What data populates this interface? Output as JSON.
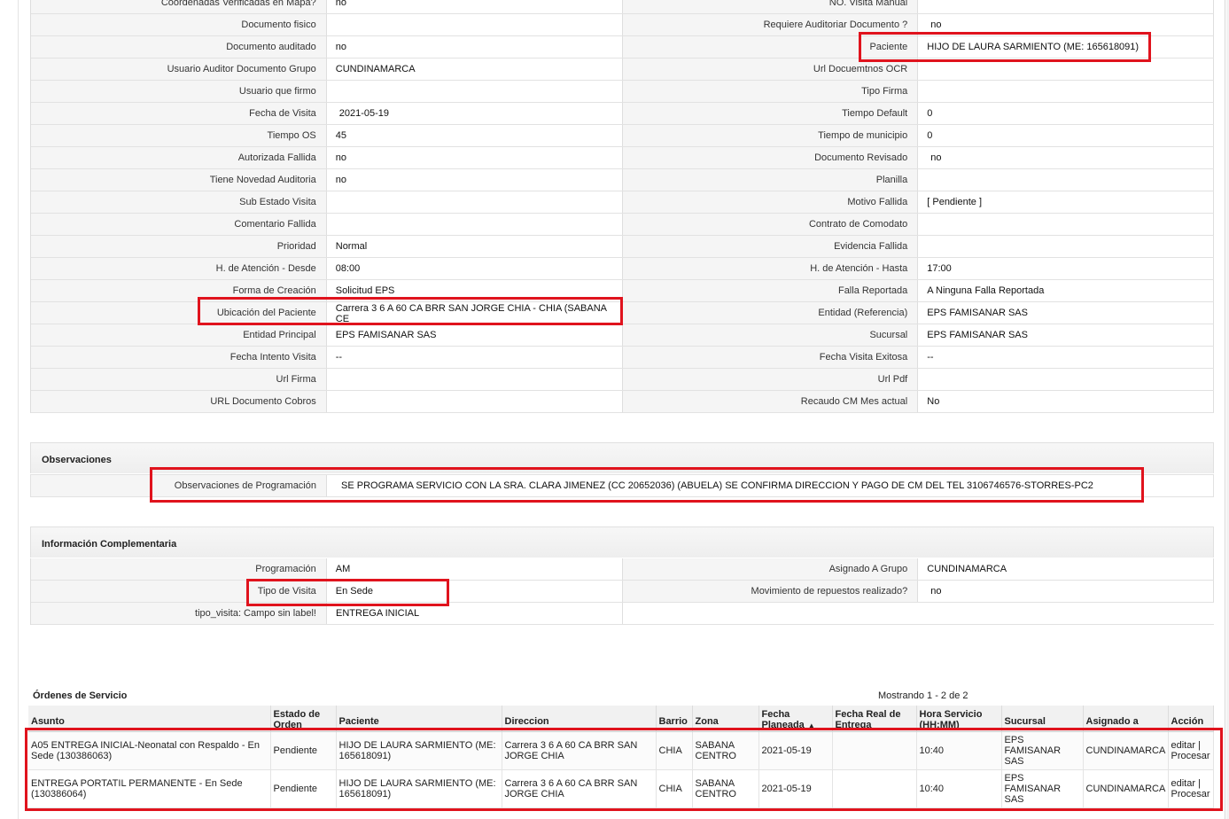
{
  "details_left": [
    {
      "label": "Coordenadas Verificadas en Mapa?",
      "value": "no"
    },
    {
      "label": "Documento fisico",
      "value": ""
    },
    {
      "label": "Documento auditado",
      "value": "no"
    },
    {
      "label": "Usuario Auditor Documento Grupo",
      "value": "CUNDINAMARCA"
    },
    {
      "label": "Usuario que firmo",
      "value": ""
    },
    {
      "label": "Fecha de Visita",
      "value": "2021-05-19"
    },
    {
      "label": "Tiempo OS",
      "value": "45"
    },
    {
      "label": "Autorizada Fallida",
      "value": "no"
    },
    {
      "label": "Tiene Novedad Auditoria",
      "value": "no"
    },
    {
      "label": "Sub Estado Visita",
      "value": ""
    },
    {
      "label": "Comentario Fallida",
      "value": ""
    },
    {
      "label": "Prioridad",
      "value": "Normal"
    },
    {
      "label": "H. de Atención - Desde",
      "value": "08:00"
    },
    {
      "label": "Forma de Creación",
      "value": "Solicitud EPS"
    },
    {
      "label": "Ubicación del Paciente",
      "value": "Carrera 3 6 A 60 CA BRR SAN JORGE CHIA - CHIA (SABANA CE"
    },
    {
      "label": "Entidad Principal",
      "value": "EPS FAMISANAR SAS"
    },
    {
      "label": "Fecha Intento Visita",
      "value": "--"
    },
    {
      "label": "Url Firma",
      "value": ""
    },
    {
      "label": "URL Documento Cobros",
      "value": ""
    }
  ],
  "details_right": [
    {
      "label": "NO. Visita Manual",
      "value": ""
    },
    {
      "label": "Requiere Auditoriar Documento ?",
      "value": "no"
    },
    {
      "label": "Paciente",
      "value": "HIJO DE LAURA SARMIENTO (ME: 165618091)"
    },
    {
      "label": "Url Docuemtnos OCR",
      "value": ""
    },
    {
      "label": "Tipo Firma",
      "value": ""
    },
    {
      "label": "Tiempo Default",
      "value": "0"
    },
    {
      "label": "Tiempo de municipio",
      "value": "0"
    },
    {
      "label": "Documento Revisado",
      "value": "no"
    },
    {
      "label": "Planilla",
      "value": ""
    },
    {
      "label": "Motivo Fallida",
      "value": "[ Pendiente ]"
    },
    {
      "label": "Contrato de Comodato",
      "value": ""
    },
    {
      "label": "Evidencia Fallida",
      "value": ""
    },
    {
      "label": "H. de Atención - Hasta",
      "value": "17:00"
    },
    {
      "label": "Falla Reportada",
      "value": "A Ninguna Falla Reportada"
    },
    {
      "label": "Entidad (Referencia)",
      "value": "EPS FAMISANAR SAS"
    },
    {
      "label": "Sucursal",
      "value": "EPS FAMISANAR SAS"
    },
    {
      "label": "Fecha Visita Exitosa",
      "value": "--"
    },
    {
      "label": "Url Pdf",
      "value": ""
    },
    {
      "label": "Recaudo CM Mes actual",
      "value": "No"
    }
  ],
  "observaciones": {
    "title": "Observaciones",
    "label": "Observaciones de Programación",
    "value": "SE PROGRAMA SERVICIO CON LA SRA. CLARA JIMENEZ (CC 20652036) (ABUELA) SE CONFIRMA DIRECCION Y PAGO DE CM DEL TEL 3106746576-STORRES-PC2"
  },
  "complementaria": {
    "title": "Información Complementaria",
    "left": [
      {
        "label": "Programación",
        "value": "AM"
      },
      {
        "label": "Tipo de Visita",
        "value": "En Sede"
      },
      {
        "label": "tipo_visita: Campo sin label!",
        "value": "ENTREGA INICIAL"
      }
    ],
    "right": [
      {
        "label": "Asignado A Grupo",
        "value": "CUNDINAMARCA"
      },
      {
        "label": "Movimiento de repuestos realizado?",
        "value": "no"
      }
    ]
  },
  "orders": {
    "title": "Órdenes de Servicio",
    "count": "Mostrando 1 - 2 de 2",
    "headers": [
      "Asunto",
      "Estado de Orden",
      "Paciente",
      "Direccion",
      "Barrio",
      "Zona",
      "Fecha Planeada",
      "Fecha Real de Entrega",
      "Hora Servicio (HH:MM)",
      "Sucursal",
      "Asignado a",
      "Acción"
    ],
    "rows": [
      {
        "asunto": "A05 ENTREGA INICIAL-Neonatal con Respaldo - En Sede (130386063)",
        "estado": "Pendiente",
        "paciente": "HIJO DE LAURA SARMIENTO (ME: 165618091)",
        "direccion": "Carrera 3 6 A 60 CA BRR SAN JORGE CHIA",
        "barrio": "CHIA",
        "zona": "SABANA CENTRO",
        "fecha_planeada": "2021-05-19",
        "fecha_real": "",
        "hora": "10:40",
        "sucursal": "EPS FAMISANAR SAS",
        "asignado": "CUNDINAMARCA",
        "editar": "editar",
        "procesar": "Procesar"
      },
      {
        "asunto": "ENTREGA PORTATIL PERMANENTE - En Sede (130386064)",
        "estado": "Pendiente",
        "paciente": "HIJO DE LAURA SARMIENTO (ME: 165618091)",
        "direccion": "Carrera 3 6 A 60 CA BRR SAN JORGE CHIA",
        "barrio": "CHIA",
        "zona": "SABANA CENTRO",
        "fecha_planeada": "2021-05-19",
        "fecha_real": "",
        "hora": "10:40",
        "sucursal": "EPS FAMISANAR SAS",
        "asignado": "CUNDINAMARCA",
        "editar": "editar",
        "procesar": "Procesar"
      }
    ]
  }
}
